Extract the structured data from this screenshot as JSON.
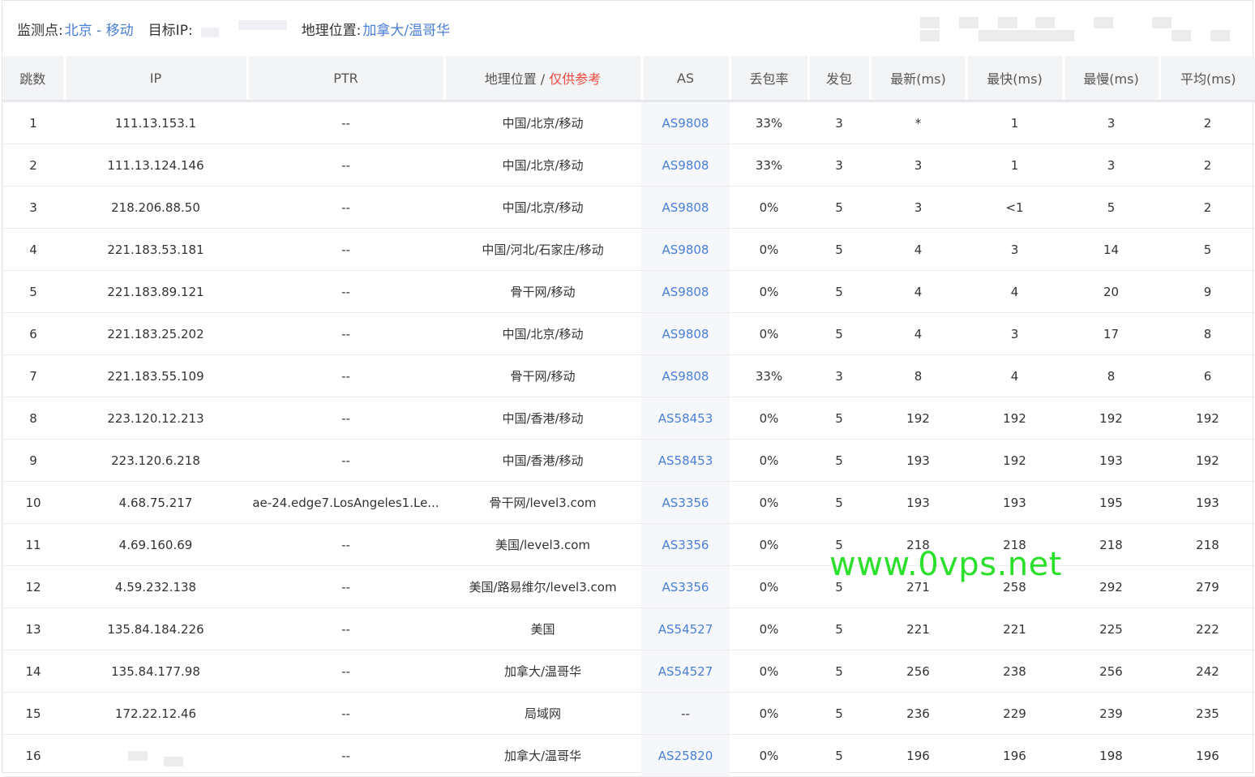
{
  "top": {
    "monitor_label": "监测点:",
    "monitor_value": "北京 - 移动",
    "target_label": "目标IP:",
    "geo_label": "地理位置:",
    "geo_value": "加拿大/温哥华"
  },
  "table": {
    "headers": [
      "跳数",
      "IP",
      "PTR",
      "地理位置",
      "AS",
      "丢包率",
      "发包",
      "最新(ms)",
      "最快(ms)",
      "最慢(ms)",
      "平均(ms)"
    ],
    "geo_header_sep": " / ",
    "geo_header_note": "仅供参考",
    "rows": [
      [
        "1",
        "111.13.153.1",
        "--",
        "中国/北京/移动",
        "AS9808",
        "33%",
        "3",
        "*",
        "1",
        "3",
        "2"
      ],
      [
        "2",
        "111.13.124.146",
        "--",
        "中国/北京/移动",
        "AS9808",
        "33%",
        "3",
        "3",
        "1",
        "3",
        "2"
      ],
      [
        "3",
        "218.206.88.50",
        "--",
        "中国/北京/移动",
        "AS9808",
        "0%",
        "5",
        "3",
        "<1",
        "5",
        "2"
      ],
      [
        "4",
        "221.183.53.181",
        "--",
        "中国/河北/石家庄/移动",
        "AS9808",
        "0%",
        "5",
        "4",
        "3",
        "14",
        "5"
      ],
      [
        "5",
        "221.183.89.121",
        "--",
        "骨干网/移动",
        "AS9808",
        "0%",
        "5",
        "4",
        "4",
        "20",
        "9"
      ],
      [
        "6",
        "221.183.25.202",
        "--",
        "中国/北京/移动",
        "AS9808",
        "0%",
        "5",
        "4",
        "3",
        "17",
        "8"
      ],
      [
        "7",
        "221.183.55.109",
        "--",
        "骨干网/移动",
        "AS9808",
        "33%",
        "3",
        "8",
        "4",
        "8",
        "6"
      ],
      [
        "8",
        "223.120.12.213",
        "--",
        "中国/香港/移动",
        "AS58453",
        "0%",
        "5",
        "192",
        "192",
        "192",
        "192"
      ],
      [
        "9",
        "223.120.6.218",
        "--",
        "中国/香港/移动",
        "AS58453",
        "0%",
        "5",
        "193",
        "192",
        "193",
        "192"
      ],
      [
        "10",
        "4.68.75.217",
        "ae-24.edge7.LosAngeles1.Le...",
        "骨干网/level3.com",
        "AS3356",
        "0%",
        "5",
        "193",
        "193",
        "195",
        "193"
      ],
      [
        "11",
        "4.69.160.69",
        "--",
        "美国/level3.com",
        "AS3356",
        "0%",
        "5",
        "218",
        "218",
        "218",
        "218"
      ],
      [
        "12",
        "4.59.232.138",
        "--",
        "美国/路易维尔/level3.com",
        "AS3356",
        "0%",
        "5",
        "271",
        "258",
        "292",
        "279"
      ],
      [
        "13",
        "135.84.184.226",
        "--",
        "美国",
        "AS54527",
        "0%",
        "5",
        "221",
        "221",
        "225",
        "222"
      ],
      [
        "14",
        "135.84.177.98",
        "--",
        "加拿大/温哥华",
        "AS54527",
        "0%",
        "5",
        "256",
        "238",
        "256",
        "242"
      ],
      [
        "15",
        "172.22.12.46",
        "--",
        "局域网",
        "--",
        "0%",
        "5",
        "236",
        "229",
        "239",
        "235"
      ],
      [
        "16",
        "",
        "--",
        "加拿大/温哥华",
        "AS25820",
        "0%",
        "5",
        "196",
        "196",
        "198",
        "196"
      ]
    ]
  },
  "watermark": "www.0vps.net",
  "colors": {
    "link": "#4a7fd8",
    "note": "#f0483e",
    "watermark": "#2be02b"
  }
}
